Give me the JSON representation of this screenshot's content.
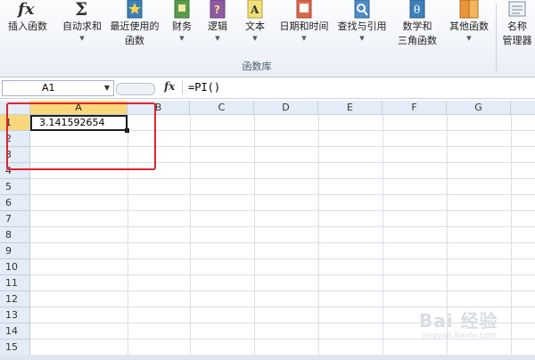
{
  "ribbon": {
    "buttons": [
      {
        "name": "insert-function-button",
        "icon": "fx-icon",
        "label": "插入函数",
        "arrow": ""
      },
      {
        "name": "autosum-button",
        "icon": "sigma-icon",
        "label": "自动求和",
        "arrow": "▼"
      },
      {
        "name": "recently-used-button",
        "icon": "star-book-icon",
        "label": "最近使用的",
        "label2": "函数",
        "arrow": "▼"
      },
      {
        "name": "financial-button",
        "icon": "finance-book-icon",
        "label": "财务",
        "arrow": "▼"
      },
      {
        "name": "logical-button",
        "icon": "logic-book-icon",
        "label": "逻辑",
        "arrow": "▼"
      },
      {
        "name": "text-button",
        "icon": "text-book-icon",
        "label": "文本",
        "arrow": "▼"
      },
      {
        "name": "datetime-button",
        "icon": "calendar-book-icon",
        "label": "日期和时间",
        "arrow": "▼"
      },
      {
        "name": "lookup-button",
        "icon": "lookup-book-icon",
        "label": "查找与引用",
        "arrow": "▼"
      },
      {
        "name": "math-trig-button",
        "icon": "theta-book-icon",
        "label": "数学和",
        "label2": "三角函数",
        "arrow": "▼"
      },
      {
        "name": "more-functions-button",
        "icon": "more-book-icon",
        "label": "其他函数",
        "arrow": "▼"
      },
      {
        "name": "name-manager-button",
        "icon": "name-manager-icon",
        "label": "名称",
        "label2": "管理器",
        "arrow": ""
      }
    ],
    "group_label": "函数库"
  },
  "formula_bar": {
    "name_box": "A1",
    "fx_label": "fx",
    "formula": "=PI()"
  },
  "grid": {
    "columns": [
      "A",
      "B",
      "C",
      "D",
      "E",
      "F",
      "G"
    ],
    "rows": [
      "1",
      "2",
      "3",
      "4",
      "5",
      "6",
      "7",
      "8",
      "9",
      "10",
      "11",
      "12",
      "13",
      "14",
      "15"
    ],
    "active_column": "A",
    "active_row": "1",
    "cell_a1": "3.141592654"
  },
  "watermark": {
    "main": "Bai 经验",
    "sub": "jingyan.baidu.com"
  },
  "colors": {
    "annotation": "#e0242e",
    "header_bg": "#e4ecf7",
    "active_header": "#f9d77b"
  }
}
